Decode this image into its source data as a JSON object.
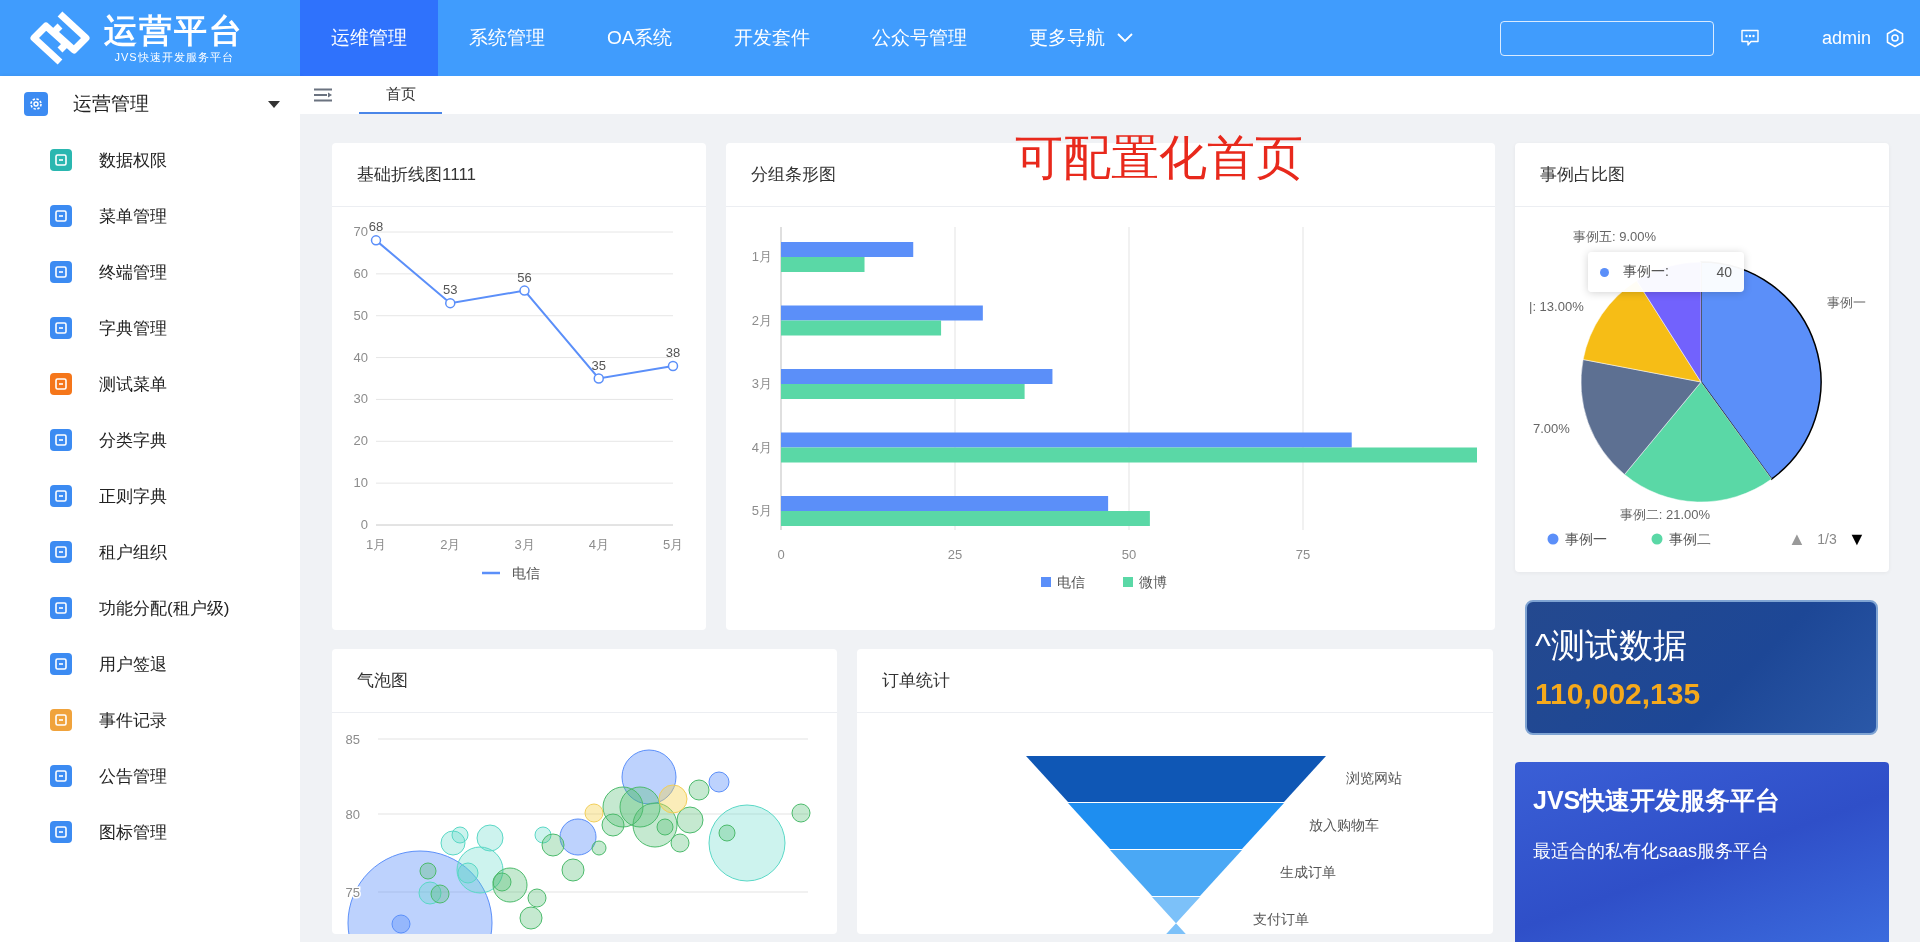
{
  "header": {
    "logo": {
      "title": "运营平台",
      "subtitle": "JVS快速开发服务平台"
    },
    "nav": [
      {
        "label": "运维管理",
        "selected": true,
        "dropdown": false
      },
      {
        "label": "系统管理",
        "selected": false,
        "dropdown": false
      },
      {
        "label": "OA系统",
        "selected": false,
        "dropdown": false
      },
      {
        "label": "开发套件",
        "selected": false,
        "dropdown": false
      },
      {
        "label": "公众号管理",
        "selected": false,
        "dropdown": false
      },
      {
        "label": "更多导航",
        "selected": false,
        "dropdown": true
      }
    ],
    "user": "admin"
  },
  "sidebar": {
    "label": "运营管理",
    "expanded": true,
    "children": [
      {
        "label": "数据权限",
        "color": "#2ab7b0"
      },
      {
        "label": "菜单管理",
        "color": "#3c8bf2"
      },
      {
        "label": "终端管理",
        "color": "#3c8bf2"
      },
      {
        "label": "字典管理",
        "color": "#3c8bf2"
      },
      {
        "label": "测试菜单",
        "color": "#f5761a"
      },
      {
        "label": "分类字典",
        "color": "#3c8bf2"
      },
      {
        "label": "正则字典",
        "color": "#3c8bf2"
      },
      {
        "label": "租户组织",
        "color": "#3c8bf2"
      },
      {
        "label": "功能分配(租户级)",
        "color": "#3c8bf2"
      },
      {
        "label": "用户签退",
        "color": "#3c8bf2"
      },
      {
        "label": "事件记录",
        "color": "#f0a33c"
      },
      {
        "label": "公告管理",
        "color": "#3c8bf2"
      },
      {
        "label": "图标管理",
        "color": "#3c8bf2"
      }
    ]
  },
  "tabs": [
    {
      "label": "首页",
      "selected": true
    }
  ],
  "page_title": "可配置化首页",
  "line_chart": {
    "title": "基础折线图1111",
    "chart_data": {
      "type": "line",
      "categories": [
        "1月",
        "2月",
        "3月",
        "4月",
        "5月"
      ],
      "series": [
        {
          "name": "电信",
          "color": "#5b8ff9",
          "values": [
            68,
            53,
            56,
            35,
            38
          ],
          "marker": "circle"
        }
      ],
      "yticks": [
        0,
        10,
        20,
        30,
        40,
        50,
        60,
        70
      ],
      "ylim": [
        0,
        70
      ],
      "data_labels": true,
      "grid": true,
      "legend": "bottom"
    }
  },
  "bar_chart": {
    "title": "分组条形图",
    "chart_data": {
      "type": "bar",
      "orientation": "horizontal",
      "categories": [
        "1月",
        "2月",
        "3月",
        "4月",
        "5月"
      ],
      "series": [
        {
          "name": "电信",
          "color": "#5b8ff9",
          "values": [
            19,
            29,
            39,
            82,
            47
          ]
        },
        {
          "name": "微博",
          "color": "#5ad8a6",
          "values": [
            12,
            23,
            35,
            100,
            53
          ]
        }
      ],
      "xticks": [
        0,
        25,
        50,
        75
      ],
      "xlim": [
        0,
        100
      ],
      "grid": true,
      "legend": "bottom"
    }
  },
  "pie_chart": {
    "title": "事例占比图",
    "chart_data": {
      "type": "pie",
      "values": [
        40,
        21,
        17,
        13,
        9
      ],
      "colors": [
        "#5b8ff9",
        "#5ad8a6",
        "#5d7092",
        "#f6bd16",
        "#7262fd"
      ]
    },
    "slice_labels": [
      "事例一",
      "事例二: 21.00%",
      "7.00%",
      "|: 13.00%",
      "事例五: 9.00%"
    ],
    "tooltip": {
      "label": "事例一:",
      "value": "40",
      "color": "#5b8ff9"
    },
    "legend": [
      {
        "label": "事例一",
        "color": "#5b8ff9"
      },
      {
        "label": "事例二",
        "color": "#5ad8a6"
      }
    ],
    "pager": {
      "prev": "▲",
      "page": "1/3",
      "next": "▼",
      "prev_disabled": true
    }
  },
  "stat_card": {
    "title": "^测试数据",
    "value": "110,002,135"
  },
  "banner": {
    "title": "JVS快速开发服务平台",
    "subtitle": "最适合的私有化saas服务平台"
  },
  "bubble_chart": {
    "title": "气泡图",
    "y_labels": [
      "85",
      "80",
      "75"
    ]
  },
  "funnel_chart": {
    "title": "订单统计",
    "stages": [
      "浏览网站",
      "放入购物车",
      "生成订单",
      "支付订单"
    ]
  }
}
